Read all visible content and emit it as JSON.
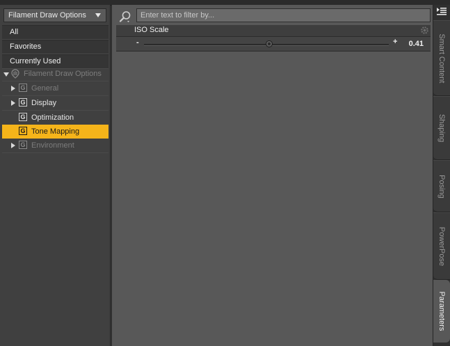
{
  "left_panel": {
    "dropdown_label": "Filament Draw Options",
    "filters": [
      "All",
      "Favorites",
      "Currently Used"
    ],
    "tree": {
      "root_label": "Filament Draw Options",
      "groups": [
        {
          "label": "General",
          "glyph": "G",
          "expandable": true,
          "dimmed": true,
          "selected": false
        },
        {
          "label": "Display",
          "glyph": "G",
          "expandable": true,
          "dimmed": false,
          "selected": false
        },
        {
          "label": "Optimization",
          "glyph": "G",
          "expandable": false,
          "dimmed": false,
          "selected": false
        },
        {
          "label": "Tone Mapping",
          "glyph": "G",
          "expandable": false,
          "dimmed": false,
          "selected": true
        },
        {
          "label": "Environment",
          "glyph": "G",
          "expandable": true,
          "dimmed": true,
          "selected": false
        }
      ]
    }
  },
  "main_panel": {
    "filter_placeholder": "Enter text to filter by...",
    "parameter": {
      "name": "ISO Scale",
      "value": "0.41",
      "slider_fraction": 0.51,
      "minus_glyph": "-",
      "plus_glyph": "+"
    }
  },
  "side_tabs": [
    "Smart Content",
    "Shaping",
    "Posing",
    "PowerPose",
    "Parameters"
  ],
  "active_side_tab": "Parameters",
  "icons": {
    "search": "magnifier-icon",
    "gear": "gear-icon",
    "menu": "panel-menu-icon",
    "root": "draw-options-icon"
  },
  "colors": {
    "selection": "#f5b41a",
    "main_bg": "#585858",
    "panel_bg": "#404040"
  }
}
